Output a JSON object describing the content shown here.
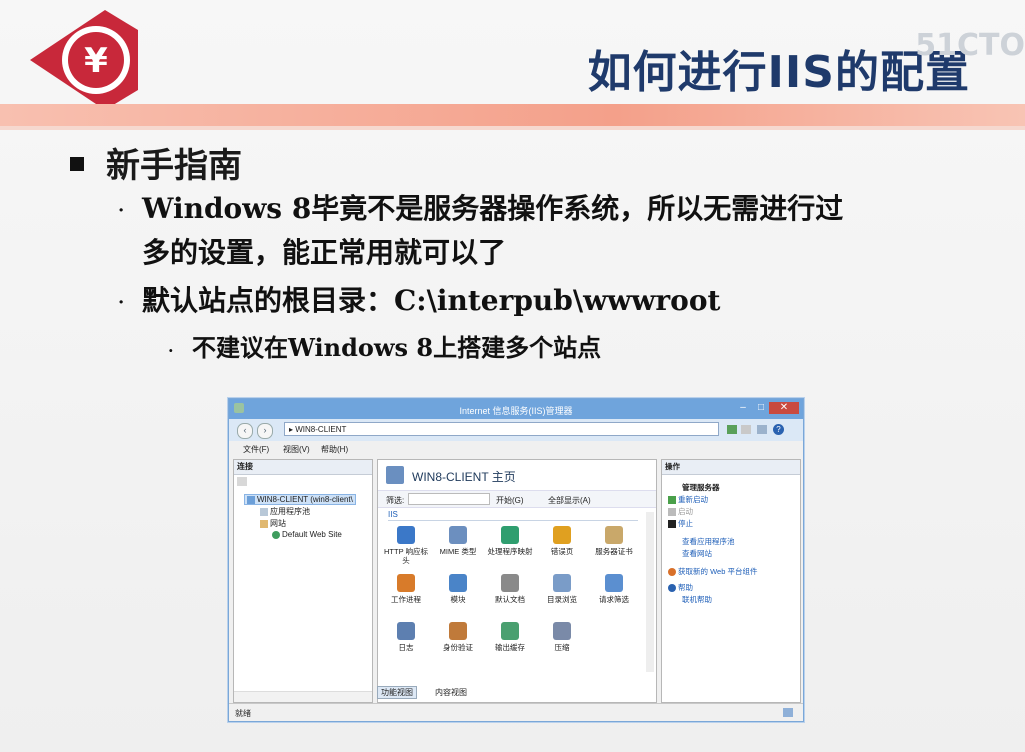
{
  "slide": {
    "title": "如何进行IIS的配置",
    "watermark": "51CTO",
    "logo_glyph": "¥",
    "bullet1": "新手指南",
    "bullet2_line1": "Windows 8毕竟不是服务器操作系统，所以无需进行过",
    "bullet2_line2": "多的设置，能正常用就可以了",
    "bullet3": "默认站点的根目录：C:\\interpub\\wwwroot",
    "bullet4": "不建议在Windows 8上搭建多个站点",
    "bullet_dot": "·",
    "colors": {
      "title": "#1f3a6b",
      "logo": "#c8283a",
      "band": "#f4a08a"
    }
  },
  "iis": {
    "window_title": "Internet 信息服务(IIS)管理器",
    "address": "WIN8-CLIENT",
    "address_sep": "▸",
    "menu": [
      "文件(F)",
      "视图(V)",
      "帮助(H)"
    ],
    "connections": {
      "header": "连接",
      "tree": [
        "WIN8-CLIENT (win8-client\\",
        "应用程序池",
        "网站",
        "Default Web Site"
      ]
    },
    "home": {
      "title": "WIN8-CLIENT 主页",
      "filter_label": "筛选:",
      "go_label": "开始(G)",
      "showall_label": "全部显示(A)",
      "group": "IIS",
      "features": [
        {
          "label": "HTTP 响应标头",
          "icon": "http-headers-icon",
          "color": "#3b78c8"
        },
        {
          "label": "MIME 类型",
          "icon": "mime-icon",
          "color": "#6c8fbf"
        },
        {
          "label": "处理程序映射",
          "icon": "handler-icon",
          "color": "#2f9e6f"
        },
        {
          "label": "错误页",
          "icon": "error-page-icon",
          "color": "#e0a020"
        },
        {
          "label": "服务器证书",
          "icon": "certificate-icon",
          "color": "#c9a86a"
        },
        {
          "label": "工作进程",
          "icon": "worker-process-icon",
          "color": "#d87b2a"
        },
        {
          "label": "模块",
          "icon": "modules-icon",
          "color": "#4a84c8"
        },
        {
          "label": "默认文档",
          "icon": "default-doc-icon",
          "color": "#8a8a8a"
        },
        {
          "label": "目录浏览",
          "icon": "dir-browse-icon",
          "color": "#7a9cc8"
        },
        {
          "label": "请求筛选",
          "icon": "request-filter-icon",
          "color": "#5b8fd0"
        },
        {
          "label": "日志",
          "icon": "logging-icon",
          "color": "#5d7fb0"
        },
        {
          "label": "身份验证",
          "icon": "auth-icon",
          "color": "#c07a3a"
        },
        {
          "label": "输出缓存",
          "icon": "output-cache-icon",
          "color": "#4aa070"
        },
        {
          "label": "压缩",
          "icon": "compression-icon",
          "color": "#7a8aa8"
        }
      ],
      "tab_features": "功能视图",
      "tab_content": "内容视图"
    },
    "actions": {
      "header": "操作",
      "section": "管理服务器",
      "restart": "重新启动",
      "start": "启动",
      "stop": "停止",
      "view_pools": "查看应用程序池",
      "view_sites": "查看网站",
      "get_components": "获取新的 Web 平台组件",
      "help": "帮助",
      "online_help": "联机帮助"
    },
    "status": "就绪"
  }
}
